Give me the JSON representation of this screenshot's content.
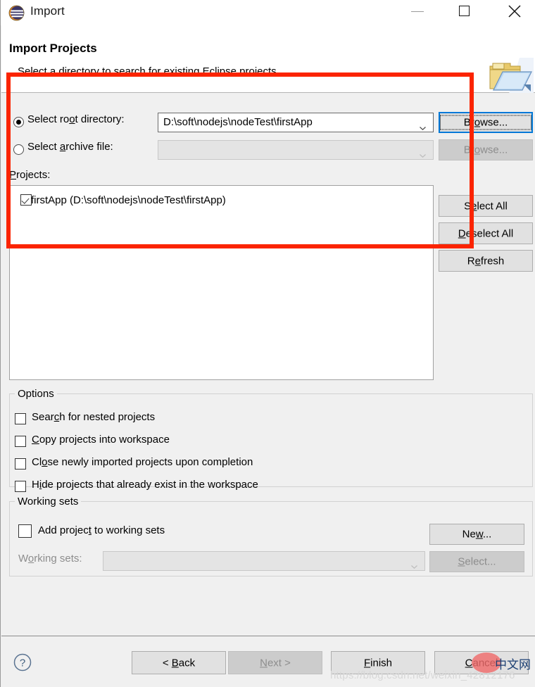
{
  "window": {
    "title": "Import",
    "icon": "eclipse-logo",
    "controls": {
      "minimize": "–",
      "maximize": "□",
      "close": "✕"
    }
  },
  "header": {
    "title": "Import Projects",
    "subtitle": "Select a directory to search for existing Eclipse projects.",
    "icon": "import-folder-icon"
  },
  "source": {
    "root_directory": {
      "label_pre": "Select ro",
      "label_mn": "o",
      "label_post": "t directory:",
      "selected": true,
      "value": "D:\\soft\\nodejs\\nodeTest\\firstApp",
      "browse_pre": "Br",
      "browse_mn": "o",
      "browse_post": "wse..."
    },
    "archive_file": {
      "label_pre": "Select ",
      "label_mn": "a",
      "label_post": "rchive file:",
      "selected": false,
      "value": "",
      "browse_pre": "Br",
      "browse_mn": "o",
      "browse_post": "wse...",
      "disabled": true
    }
  },
  "projects": {
    "label_mn": "P",
    "label_post": "rojects:",
    "items": [
      {
        "label": "firstApp (D:\\soft\\nodejs\\nodeTest\\firstApp)",
        "checked": true
      }
    ],
    "buttons": {
      "select_all": {
        "pre": "S",
        "mn": "e",
        "post": "lect All"
      },
      "deselect_all": {
        "pre": "",
        "mn": "D",
        "post": "eselect All"
      },
      "refresh": {
        "pre": "R",
        "mn": "e",
        "post": "fresh"
      }
    }
  },
  "options": {
    "title": "Options",
    "items": [
      {
        "pre": "Sear",
        "mn": "c",
        "post": "h for nested projects",
        "checked": false
      },
      {
        "pre": "",
        "mn": "C",
        "post": "opy projects into workspace",
        "checked": false
      },
      {
        "pre": "Cl",
        "mn": "o",
        "post": "se newly imported projects upon completion",
        "checked": false
      },
      {
        "pre": "H",
        "mn": "i",
        "post": "de projects that already exist in the workspace",
        "checked": false
      }
    ]
  },
  "working_sets": {
    "title": "Working sets",
    "add_checkbox": {
      "pre": "Add projec",
      "mn": "t",
      "post": " to working sets",
      "checked": false
    },
    "new_button": {
      "pre": "Ne",
      "mn": "w",
      "post": "..."
    },
    "combo_label": {
      "pre": "W",
      "mn": "o",
      "post": "rking sets:",
      "disabled": true
    },
    "combo_value": "",
    "select_button": {
      "pre": "",
      "mn": "S",
      "post": "elect...",
      "disabled": true
    }
  },
  "footer": {
    "help_icon": "help-question-icon",
    "back": {
      "pre": "< ",
      "mn": "B",
      "post": "ack"
    },
    "next": {
      "pre": "",
      "mn": "N",
      "post": "ext >",
      "disabled": true
    },
    "finish": {
      "pre": "",
      "mn": "F",
      "post": "inish"
    },
    "cancel": {
      "pre": "",
      "mn": "C",
      "post": "ancel"
    }
  },
  "annotation": {
    "color": "#fb2400",
    "shape": "rectangle"
  },
  "watermark": {
    "url": "https://blog.csdn.net/weixin_42812176",
    "logo_text": "中文网",
    "logo_color": "#ef6b6b"
  }
}
